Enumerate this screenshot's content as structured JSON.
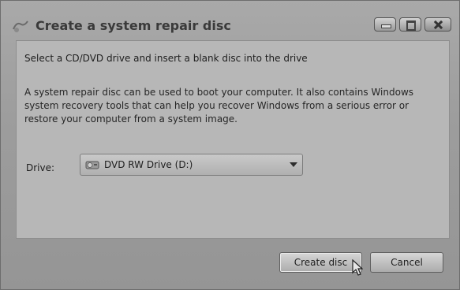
{
  "window": {
    "title": "Create a system repair disc"
  },
  "content": {
    "instruction": "Select a CD/DVD drive and insert a blank disc into the drive",
    "description": "A system repair disc can be used to boot your computer. It also contains Windows system recovery tools that can help you recover Windows from a serious error or restore your computer from a system image.",
    "drive_label": "Drive:",
    "drive_selected": "DVD RW Drive (D:)"
  },
  "buttons": {
    "create": "Create disc",
    "cancel": "Cancel"
  },
  "icons": {
    "title": "repair-disc-icon",
    "drive": "dvd-drive-icon",
    "cursor": "mouse-cursor-icon"
  }
}
